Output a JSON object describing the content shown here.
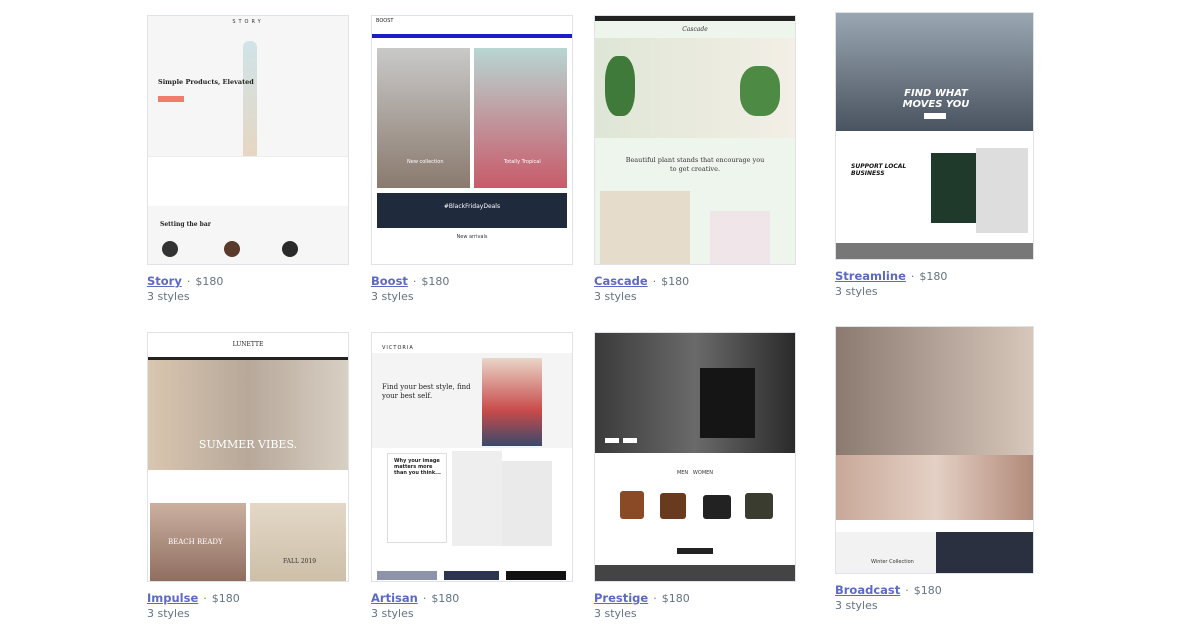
{
  "themes": [
    {
      "name": "Story",
      "price": "$180",
      "styles": "3 styles",
      "preview": {
        "logo": "STORY",
        "headline": "Simple Products, Elevated",
        "section": "Setting the bar"
      }
    },
    {
      "name": "Boost",
      "price": "$180",
      "styles": "3 styles",
      "preview": {
        "logo": "BOOST",
        "left": "New collection",
        "right": "Totally Tropical",
        "banner": "#BlackFridayDeals",
        "footer": "New arrivals"
      }
    },
    {
      "name": "Cascade",
      "price": "$180",
      "styles": "3 styles",
      "preview": {
        "logo": "Cascade",
        "headline": "Beautiful plant stands that encourage you to get creative."
      }
    },
    {
      "name": "Streamline",
      "price": "$180",
      "styles": "3 styles",
      "preview": {
        "headline": "FIND WHAT MOVES YOU",
        "section": "SUPPORT LOCAL BUSINESS"
      }
    },
    {
      "name": "Impulse",
      "price": "$180",
      "styles": "3 styles",
      "preview": {
        "logo": "LUNETTE",
        "headline": "SUMMER VIBES.",
        "left": "BEACH READY",
        "right": "FALL 2019"
      }
    },
    {
      "name": "Artisan",
      "price": "$180",
      "styles": "3 styles",
      "preview": {
        "logo": "VICTORIA",
        "headline": "Find your best style, find your best self.",
        "section": "Why your image matters more than you think..."
      }
    },
    {
      "name": "Prestige",
      "price": "$180",
      "styles": "3 styles",
      "preview": {
        "tabs": "MEN   WOMEN"
      }
    },
    {
      "name": "Broadcast",
      "price": "$180",
      "styles": "3 styles",
      "preview": {
        "section": "Winter Collection"
      }
    }
  ],
  "colors": {
    "link": "#5c6ac4",
    "meta": "#637381"
  }
}
